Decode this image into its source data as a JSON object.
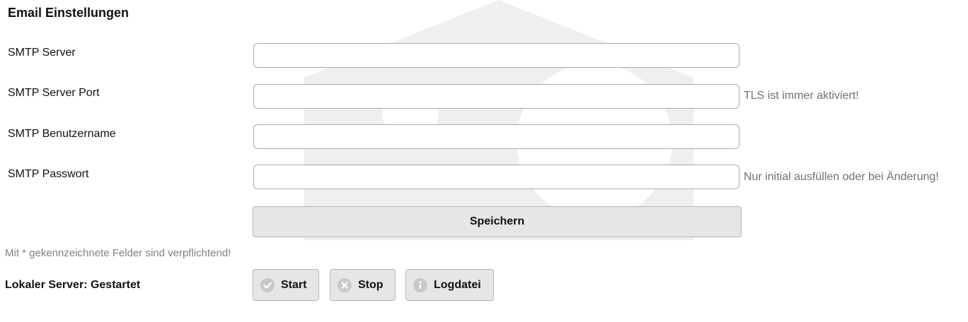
{
  "section_title": "Email Einstellungen",
  "fields": [
    {
      "label": "SMTP Server",
      "value": "",
      "hint": ""
    },
    {
      "label": "SMTP Server Port",
      "value": "",
      "hint": "TLS ist immer aktiviert!"
    },
    {
      "label": "SMTP Benutzername",
      "value": "",
      "hint": ""
    },
    {
      "label": "SMTP Passwort",
      "value": "",
      "hint": "Nur initial ausfüllen oder bei Änderung!"
    }
  ],
  "save_label": "Speichern",
  "required_note": "Mit * gekennzeichnete Felder sind verpflichtend!",
  "server": {
    "status_text": "Lokaler Server: Gestartet",
    "buttons": {
      "start": {
        "label": "Start",
        "icon": "check-icon"
      },
      "stop": {
        "label": "Stop",
        "icon": "close-icon"
      },
      "log": {
        "label": "Logdatei",
        "icon": "info-icon"
      }
    }
  },
  "colors": {
    "button_bg": "#e6e6e6",
    "hint_text": "#707070",
    "icon_gray": "#c8c8c8"
  }
}
